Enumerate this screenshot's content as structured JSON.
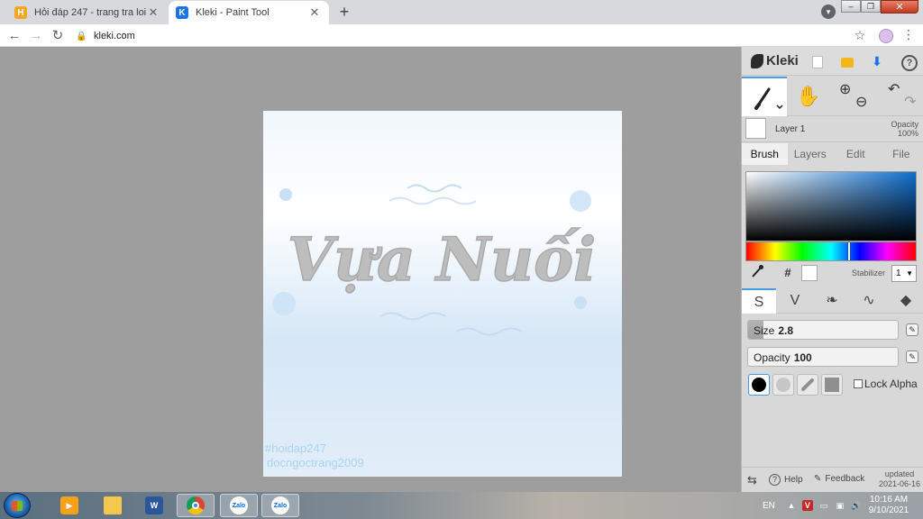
{
  "browser": {
    "tabs": [
      {
        "title": "Hỏi đáp 247 - trang tra loi",
        "favicon": "H",
        "favicon_color": "#f5a623",
        "active": false
      },
      {
        "title": "Kleki - Paint Tool",
        "favicon": "K",
        "favicon_color": "#1a73e8",
        "active": true
      }
    ],
    "new_tab": "+",
    "url": "kleki.com",
    "controls": {
      "back": "←",
      "forward": "→",
      "reload": "↻",
      "bookmark": "☆",
      "menu": "⋮",
      "close": "✕",
      "minimize": "–",
      "restore": "❐",
      "tabsearch": "▾"
    }
  },
  "canvas": {
    "artwork_text": "Vựa Nuối",
    "hashtag": "#hoidap247",
    "author": "docngoctrang2009",
    "background": "#e7f1fb",
    "text_color": "#bdbdbd"
  },
  "kleki": {
    "brand": "Kleki",
    "header_icons": [
      "new-image-icon",
      "open-folder-icon",
      "download-icon",
      "help-icon"
    ],
    "help_label": "?",
    "save_glyph": "⬇",
    "tools": {
      "brush": "brush-icon",
      "hand": "✋",
      "zoom_in": "⊕",
      "zoom_out": "⊖",
      "undo": "↶",
      "redo": "↷"
    },
    "layer": {
      "name": "Layer 1",
      "opacity_label": "Opacity",
      "opacity_value": "100%"
    },
    "tabs": [
      "Brush",
      "Layers",
      "Edit",
      "File"
    ],
    "active_tab": "Brush",
    "color": {
      "hue_position": 0.6,
      "picker_glyph": "⁄",
      "hex_label": "#",
      "current": "#ffffff"
    },
    "stabilizer": {
      "label": "Stabilizer",
      "value": "1"
    },
    "brush_types": [
      "S",
      "V",
      "❧",
      "∿",
      "◆"
    ],
    "size": {
      "label": "Size",
      "value": "2.8",
      "level": 0.1
    },
    "opacity": {
      "label": "Opacity",
      "value": "100",
      "level": 1.0
    },
    "lock_alpha": "Lock Alpha",
    "footer": {
      "swap": "⇆",
      "help_icon": "?",
      "help": "Help",
      "feedback": "Feedback",
      "updated_label": "updated",
      "updated_date": "2021-06-16"
    }
  },
  "taskbar": {
    "apps": [
      "media-player",
      "file-explorer",
      "word",
      "chrome",
      "zalo",
      "zalo-2"
    ],
    "word_label": "W",
    "zalo_label": "Zalo",
    "language": "EN",
    "tray_glyphs": [
      "▲",
      "V",
      "▭",
      "▣",
      "🔊"
    ],
    "time": "10:16 AM",
    "date": "9/10/2021"
  }
}
